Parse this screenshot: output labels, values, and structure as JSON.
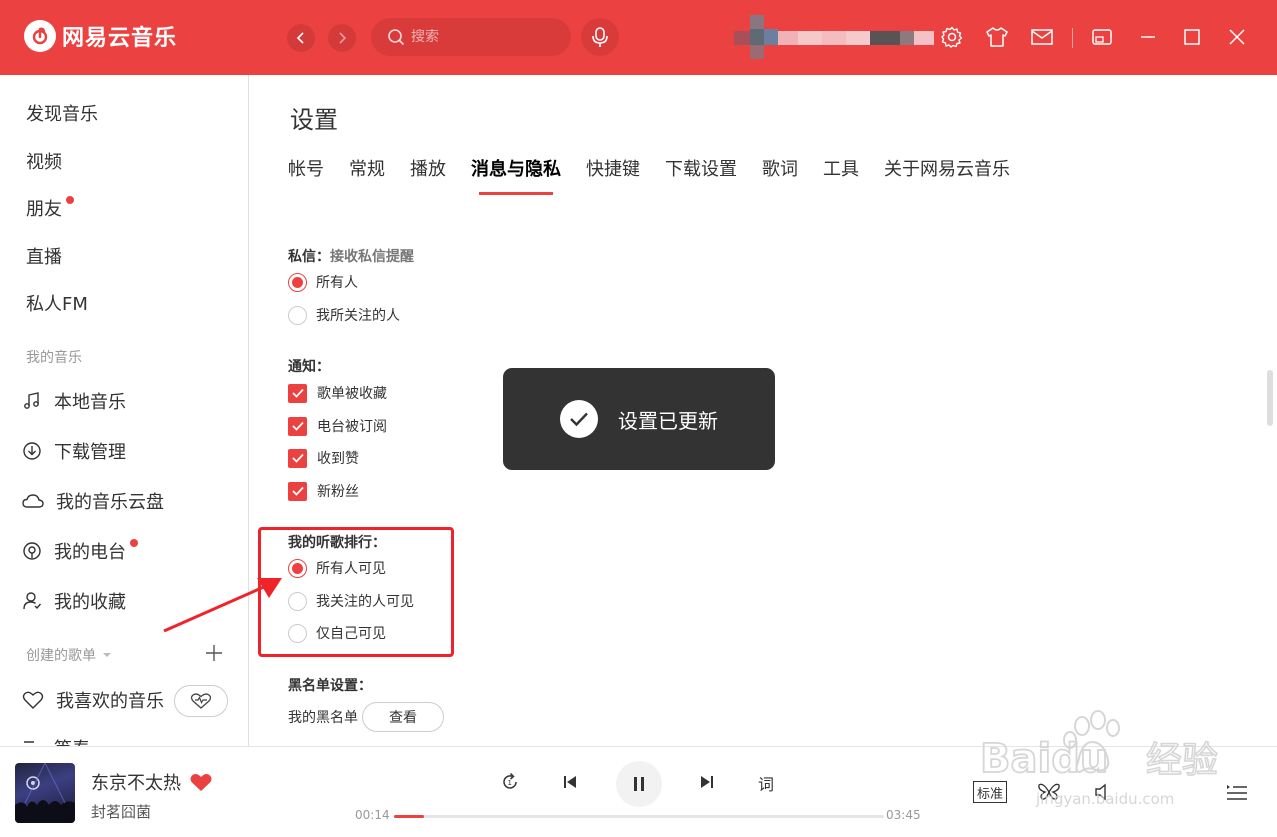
{
  "app": {
    "name": "网易云音乐"
  },
  "titlebar": {
    "search_placeholder": "搜索"
  },
  "sidebar": {
    "top_items": [
      {
        "label": "发现音乐",
        "dot": false
      },
      {
        "label": "视频",
        "dot": false
      },
      {
        "label": "朋友",
        "dot": true
      },
      {
        "label": "直播",
        "dot": false
      },
      {
        "label": "私人FM",
        "dot": false
      }
    ],
    "my_music_heading": "我的音乐",
    "my_music_items": [
      {
        "label": "本地音乐",
        "icon": "music-note-icon"
      },
      {
        "label": "下载管理",
        "icon": "download-icon"
      },
      {
        "label": "我的音乐云盘",
        "icon": "cloud-icon"
      },
      {
        "label": "我的电台",
        "icon": "radio-icon",
        "dot": true
      },
      {
        "label": "我的收藏",
        "icon": "collection-icon"
      }
    ],
    "created_playlists_heading": "创建的歌单",
    "liked_music": "我喜欢的音乐",
    "partial_item": "等春"
  },
  "settings": {
    "title": "设置",
    "tabs": [
      "帐号",
      "常规",
      "播放",
      "消息与隐私",
      "快捷键",
      "下载设置",
      "歌词",
      "工具",
      "关于网易云音乐"
    ],
    "active_tab": "消息与隐私",
    "private_msg": {
      "label": "私信：",
      "desc": "接收私信提醒",
      "options": [
        "所有人",
        "我所关注的人"
      ],
      "selected": 0
    },
    "notify": {
      "label": "通知：",
      "options": [
        "歌单被收藏",
        "电台被订阅",
        "收到赞",
        "新粉丝"
      ]
    },
    "ranking": {
      "label": "我的听歌排行：",
      "options": [
        "所有人可见",
        "我关注的人可见",
        "仅自己可见"
      ],
      "selected": 0
    },
    "blacklist": {
      "label": "黑名单设置：",
      "item": "我的黑名单",
      "button": "查看"
    }
  },
  "toast": {
    "text": "设置已更新"
  },
  "player": {
    "song": "东京不太热",
    "artist": "封茗囧菌",
    "current_time": "00:14",
    "total_time": "03:45",
    "progress": 0.062,
    "lyric_btn": "词",
    "quality": "标准"
  },
  "watermark": {
    "brand": "Baidu",
    "suffix": "经验",
    "url": "jingyan.baidu.com"
  },
  "colors": {
    "brand_red": "#ec4141",
    "highlight_red": "#f0232a"
  }
}
